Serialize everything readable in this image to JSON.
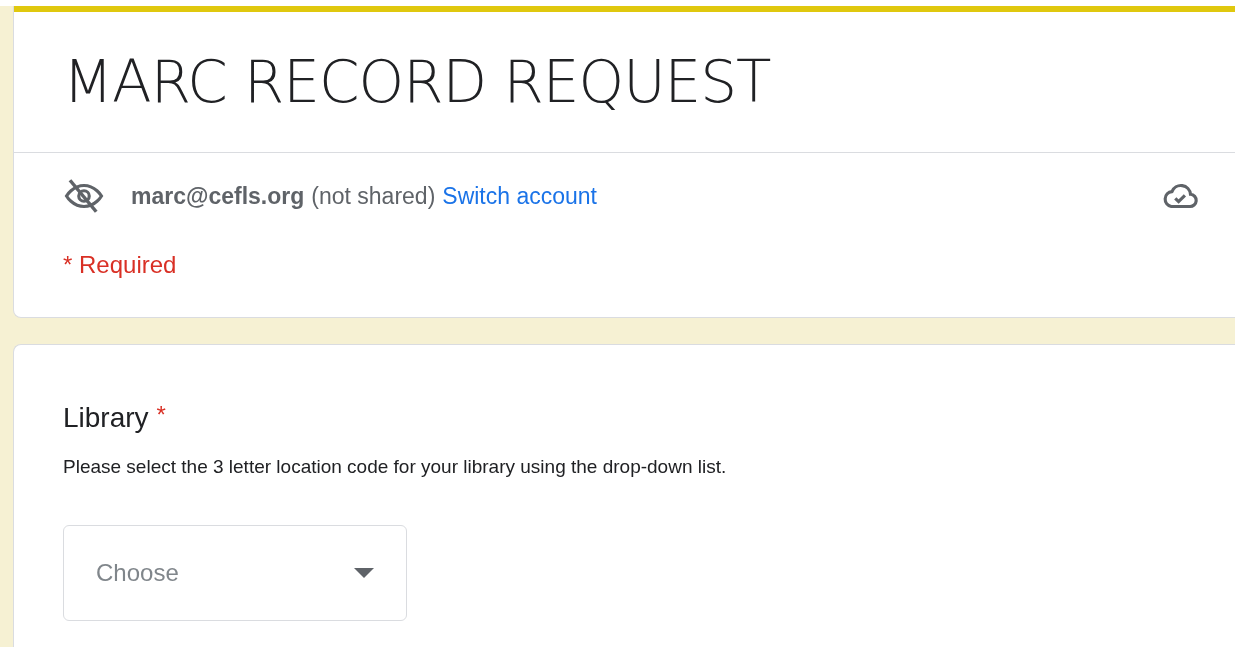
{
  "form": {
    "title": "MARC RECORD REQUEST"
  },
  "account": {
    "email": "marc@cefls.org",
    "note": "(not shared)",
    "switch_link": "Switch account"
  },
  "required_note": "* Required",
  "questions": [
    {
      "label": "Library",
      "required": true,
      "required_mark": "*",
      "description": "Please select the 3 letter location code for your library using the drop-down list.",
      "dropdown": {
        "placeholder": "Choose"
      }
    }
  ]
}
